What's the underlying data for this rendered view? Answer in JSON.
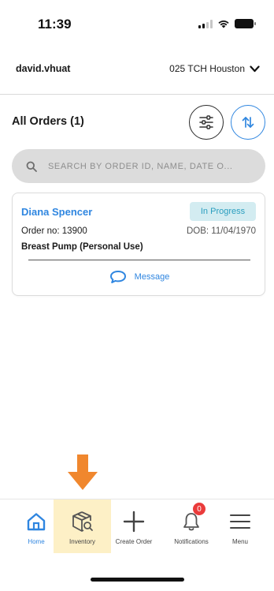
{
  "status_bar": {
    "time": "11:39"
  },
  "header": {
    "username": "david.vhuat",
    "location": "025 TCH Houston"
  },
  "orders": {
    "title": "All Orders (1)"
  },
  "search": {
    "placeholder": "SEARCH BY ORDER ID, NAME, DATE O..."
  },
  "order_card": {
    "patient_name": "Diana Spencer",
    "status": "In Progress",
    "order_no": "Order no: 13900",
    "dob": "DOB: 11/04/1970",
    "product": "Breast Pump (Personal Use)",
    "message_label": "Message"
  },
  "tab_bar": {
    "items": [
      {
        "label": "Home",
        "icon": "home-icon",
        "active": true
      },
      {
        "label": "Inventory",
        "icon": "inventory-icon",
        "highlighted": true
      },
      {
        "label": "Create Order",
        "icon": "plus-icon"
      },
      {
        "label": "Notifications",
        "icon": "bell-icon",
        "badge": "0"
      },
      {
        "label": "Menu",
        "icon": "hamburger-icon"
      }
    ]
  },
  "colors": {
    "accent": "#2f86e0",
    "status_badge_bg": "#d3ecf1",
    "status_badge_text": "#2a9ebf",
    "highlight": "#fdf0c6",
    "arrow": "#f0872e",
    "notification_badge": "#ea3b3b"
  }
}
